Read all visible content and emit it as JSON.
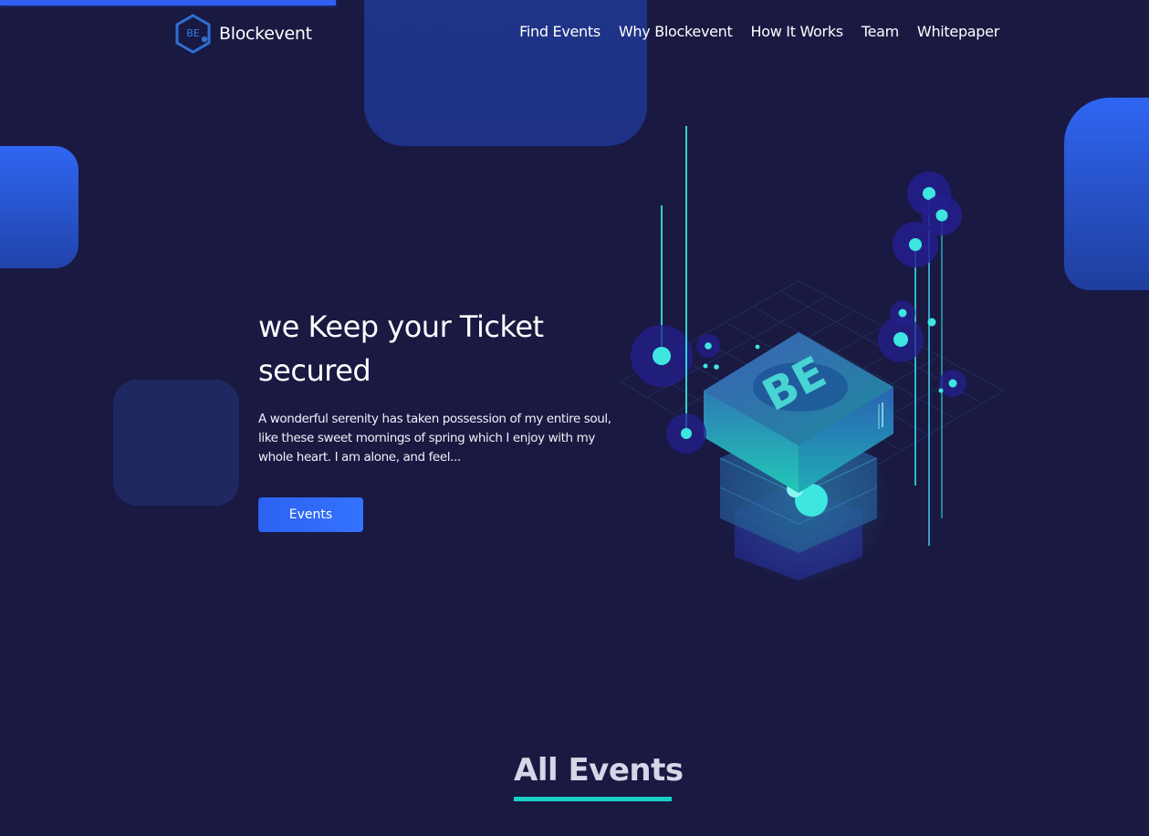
{
  "header": {
    "brand": "Blockevent",
    "logo_text": "BE",
    "nav": [
      {
        "label": "Find Events"
      },
      {
        "label": "Why Blockevent"
      },
      {
        "label": "How It Works"
      },
      {
        "label": "Team"
      },
      {
        "label": "Whitepaper"
      }
    ]
  },
  "hero": {
    "title_line1": "we Keep your Ticket",
    "title_line2": "secured",
    "description": "A wonderful serenity has taken possession of my entire soul, like these sweet mornings of spring which I enjoy with my whole heart. I am alone, and feel...",
    "button_label": "Events",
    "illustration_text": "BE"
  },
  "section": {
    "title": "All Events"
  },
  "colors": {
    "background": "#191942",
    "accent_blue": "#2f66f2",
    "accent_teal": "#18d0c8",
    "teal_glow": "#3ee6e0"
  },
  "icons": {
    "logo": "blockevent-hexagon-logo-icon"
  }
}
